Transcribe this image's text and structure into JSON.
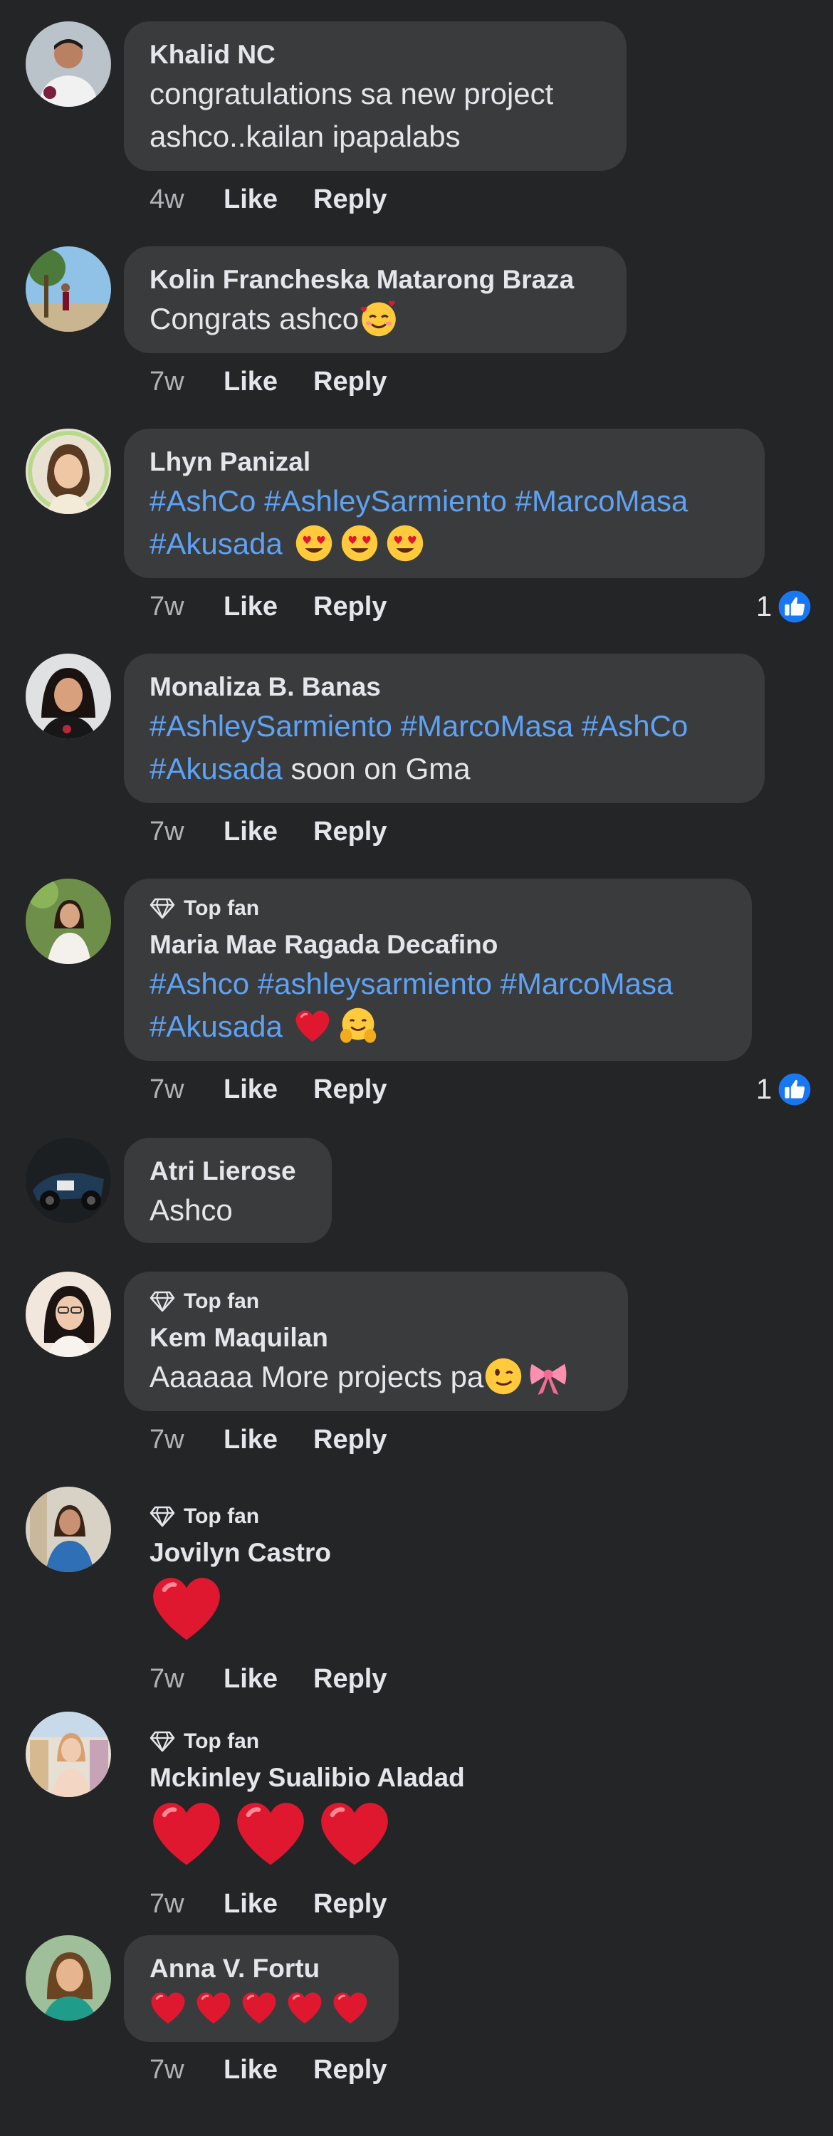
{
  "colors": {
    "background": "#242526",
    "bubble": "#3a3b3c",
    "text": "#e4e6eb",
    "muted": "#b0b3b8",
    "hashtag": "#5ea2f5",
    "like_badge": "#1877f2"
  },
  "comments": [
    {
      "author": "Khalid NC",
      "lines": [
        "congratulations sa new project",
        "ashco..kailan ipapalabs"
      ],
      "time": "4w",
      "like": "Like",
      "reply": "Reply"
    },
    {
      "author": "Kolin Francheska Matarong Braza",
      "lines": [
        "Congrats ashco"
      ],
      "emoji": "smiling-face-with-hearts",
      "time": "7w",
      "like": "Like",
      "reply": "Reply"
    },
    {
      "author": "Lhyn Panizal",
      "tags_line1": "#AshCo #AshleySarmiento #MarcoMasa",
      "tags_line2": "#Akusada",
      "emoji": "heart-eyes x3",
      "time": "7w",
      "like": "Like",
      "reply": "Reply",
      "reactions": "1"
    },
    {
      "author": "Monaliza B. Banas",
      "tags_line1": "#AshleySarmiento #MarcoMasa #AshCo",
      "tags_line2": "#Akusada",
      "suffix": " soon on Gma",
      "time": "7w",
      "like": "Like",
      "reply": "Reply"
    },
    {
      "badge": "Top fan",
      "author": "Maria Mae Ragada Decafino",
      "tags_line1": "#Ashco #ashleysarmiento #MarcoMasa",
      "tags_line2": "#Akusada",
      "emoji": "red-heart, hugging-face",
      "time": "7w",
      "like": "Like",
      "reply": "Reply",
      "reactions": "1"
    },
    {
      "author": "Atri Lierose",
      "lines": [
        "Ashco"
      ]
    },
    {
      "badge": "Top fan",
      "author": "Kem Maquilan",
      "lines": [
        "Aaaaaa More projects pa"
      ],
      "emoji": "winking-face, ribbon",
      "time": "7w",
      "like": "Like",
      "reply": "Reply"
    },
    {
      "badge": "Top fan",
      "author": "Jovilyn Castro",
      "emoji": "red-heart",
      "time": "7w",
      "like": "Like",
      "reply": "Reply"
    },
    {
      "badge": "Top fan",
      "author": "Mckinley Sualibio Aladad",
      "emoji": "red-heart x3",
      "time": "7w",
      "like": "Like",
      "reply": "Reply"
    },
    {
      "author": "Anna V. Fortu",
      "emoji": "red-heart x5",
      "time": "7w",
      "like": "Like",
      "reply": "Reply"
    }
  ]
}
